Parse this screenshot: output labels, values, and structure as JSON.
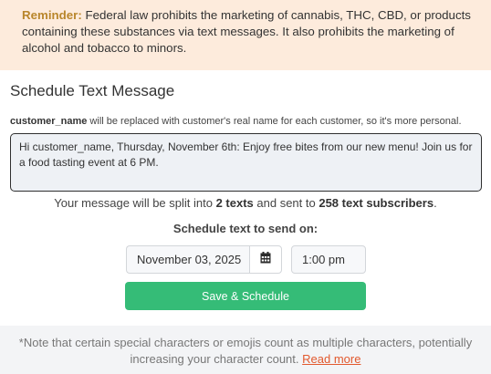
{
  "reminder": {
    "label": "Reminder:",
    "text": " Federal law prohibits the marketing of cannabis, THC, CBD, or products containing these substances via text messages. It also prohibits the marketing of alcohol and tobacco to minors."
  },
  "title": "Schedule Text Message",
  "hint": {
    "token": "customer_name",
    "text": " will be replaced with customer's real name for each customer, so it's more personal."
  },
  "message": {
    "value": "Hi customer_name, Thursday, November 6th:  Enjoy free bites from our new menu! Join us for a food tasting event at 6 PM."
  },
  "split": {
    "prefix": "Your message will be split into ",
    "texts": "2 texts",
    "middle": " and sent to ",
    "subscribers": "258 text subscribers",
    "suffix": "."
  },
  "schedule": {
    "label": "Schedule text to send on:",
    "date": "November 03, 2025",
    "calendar_icon": "calendar-icon",
    "time": "1:00 pm"
  },
  "save_button": "Save & Schedule",
  "footer": {
    "note": "*Note that certain special characters or emojis count as multiple characters, potentially increasing your character count. ",
    "link": "Read more"
  },
  "colors": {
    "reminder_bg": "#fdebdc",
    "reminder_label": "#b9862b",
    "save_button": "#35bc77",
    "link": "#e2592e",
    "footer_bg": "#f3f4f6"
  }
}
